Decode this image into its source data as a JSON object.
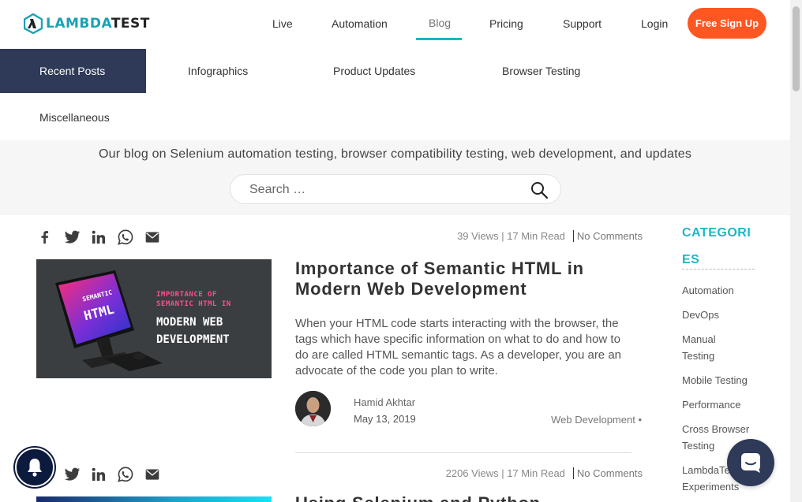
{
  "brand": {
    "name_part1": "LAMBDA",
    "name_part2": "TEST"
  },
  "nav": {
    "items": [
      "Live",
      "Automation",
      "Blog",
      "Pricing",
      "Support",
      "Login"
    ],
    "active": "Blog",
    "signup_label": "Free Sign Up"
  },
  "categories": {
    "items": [
      "Recent Posts",
      "Infographics",
      "Product Updates",
      "Browser Testing",
      "Miscellaneous"
    ],
    "active": "Recent Posts"
  },
  "hero": {
    "tagline": "Our blog on Selenium automation testing, browser compatibility testing, web development, and updates",
    "search_placeholder": "Search …"
  },
  "posts": [
    {
      "views": "39 Views",
      "read_time": "17 Min Read",
      "comments": "No Comments",
      "title": "Importance of Semantic HTML in Modern Web Development",
      "thumb_text": {
        "line1": "IMPORTANCE OF",
        "line2": "SEMANTIC HTML IN",
        "line3": "MODERN WEB",
        "line4": "DEVELOPMENT",
        "screen1": "SEMANTIC",
        "screen2": "HTML"
      },
      "excerpt": "When your HTML code starts interacting with the browser, the tags which have specific information on what to do and how to do are called HTML semantic tags. As a developer, you are an advocate of the code you plan to write.",
      "author": "Hamid Akhtar",
      "date": "May 13, 2019",
      "category": "Web Development •"
    },
    {
      "views": "2206 Views",
      "read_time": "17 Min Read",
      "comments": "No Comments",
      "title": "Using Selenium and Python"
    }
  ],
  "sidebar": {
    "heading": "CATEGORIES",
    "items": [
      "Automation",
      "DevOps",
      "Manual Testing",
      "Mobile Testing",
      "Performance",
      "Cross Browser Testing",
      "LambdaTest Experiments"
    ]
  },
  "colors": {
    "accent": "#1bb7c7",
    "cta": "#ff5722",
    "navy": "#2e3a58"
  }
}
